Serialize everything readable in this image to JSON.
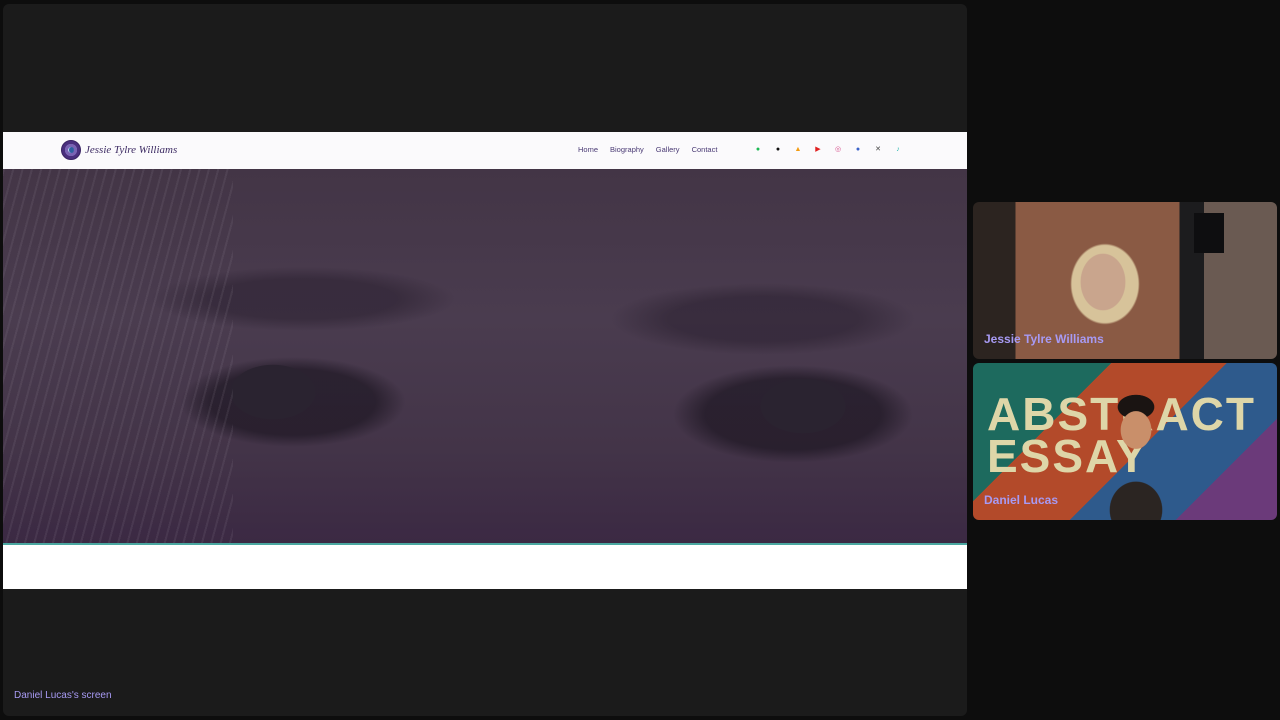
{
  "shared_screen": {
    "site": {
      "brand_name": "Jessie Tylre Williams",
      "nav": [
        {
          "label": "Home"
        },
        {
          "label": "Biography"
        },
        {
          "label": "Gallery"
        },
        {
          "label": "Contact"
        }
      ],
      "socials": [
        {
          "icon": "spotify-icon",
          "glyph": "●",
          "color": "#1db954"
        },
        {
          "icon": "apple-icon",
          "glyph": "●",
          "color": "#111111"
        },
        {
          "icon": "amazon-icon",
          "glyph": "▲",
          "color": "#f39c12"
        },
        {
          "icon": "youtube-icon",
          "glyph": "▶",
          "color": "#e02020"
        },
        {
          "icon": "instagram-icon",
          "glyph": "◎",
          "color": "#d6508c"
        },
        {
          "icon": "facebook-icon",
          "glyph": "●",
          "color": "#3b63c9"
        },
        {
          "icon": "x-icon",
          "glyph": "✕",
          "color": "#444444"
        },
        {
          "icon": "tiktok-icon",
          "glyph": "♪",
          "color": "#2fb8b0"
        }
      ],
      "hero_caption": "",
      "accent_color": "#4aa7a0"
    },
    "label": "Daniel Lucas's screen"
  },
  "participants": [
    {
      "name": "Jessie Tylre Williams"
    },
    {
      "name": "Daniel Lucas",
      "background_text": "ABSTRACT ESSAY"
    }
  ]
}
